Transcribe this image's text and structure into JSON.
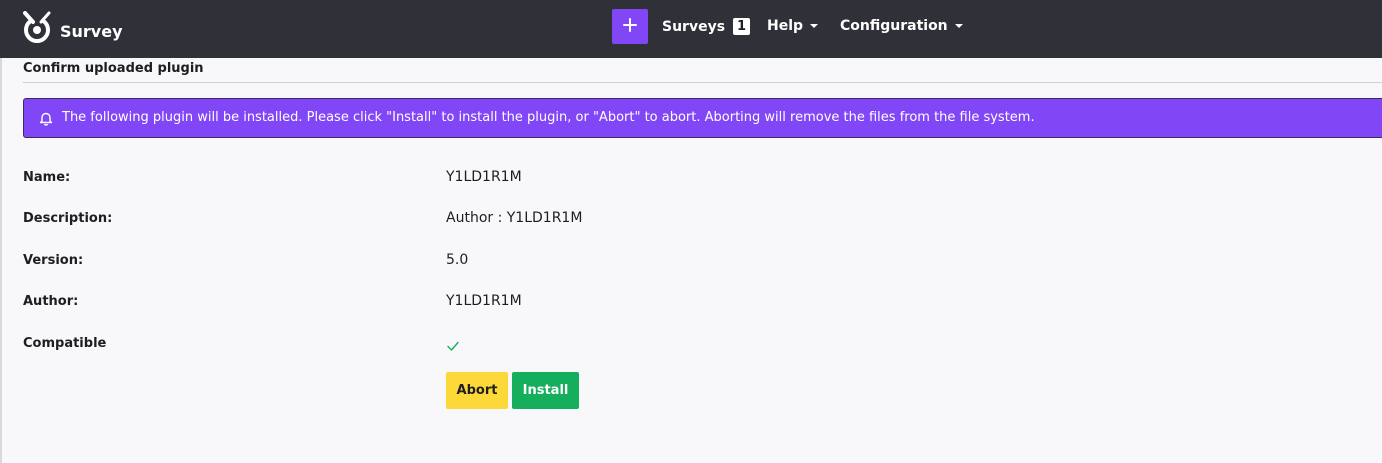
{
  "header": {
    "brand": "Survey",
    "create_icon": "plus-icon",
    "nav": [
      {
        "label": "Surveys",
        "badge": "1"
      },
      {
        "label": "Help"
      },
      {
        "label": "Configuration"
      }
    ]
  },
  "page": {
    "title": "Confirm uploaded plugin",
    "alert": {
      "icon": "bell-icon",
      "text": "The following plugin will be installed. Please click \"Install\" to install the plugin, or \"Abort\" to abort. Aborting will remove the files from the file system."
    },
    "fields": {
      "name": {
        "label": "Name:",
        "value": "Y1LD1R1M"
      },
      "description": {
        "label": "Description:",
        "value": "Author : Y1LD1R1M"
      },
      "version": {
        "label": "Version:",
        "value": "5.0"
      },
      "author": {
        "label": "Author:",
        "value": "Y1LD1R1M"
      },
      "compatible": {
        "label": "Compatible",
        "icon": "check-icon"
      }
    },
    "buttons": {
      "abort": "Abort",
      "install": "Install"
    }
  },
  "colors": {
    "topbar": "#2f3038",
    "accent": "#8146f6",
    "abort": "#fcd939",
    "install": "#14ae5c",
    "check": "#14ae5c"
  }
}
